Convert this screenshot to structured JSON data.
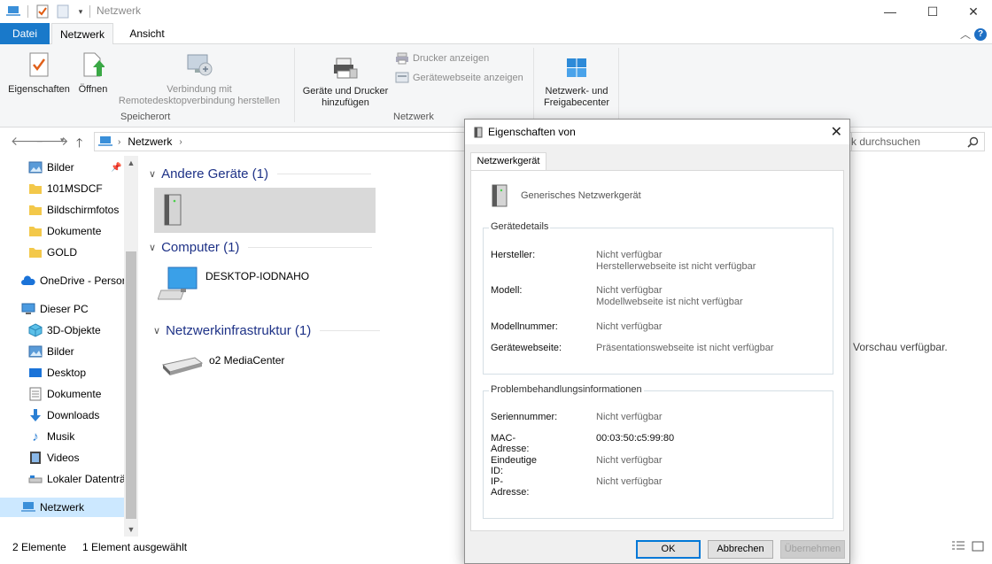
{
  "window": {
    "title": "Netzwerk",
    "minimize_glyph": "—",
    "maximize_glyph": "☐",
    "close_glyph": "✕"
  },
  "ribbon_tabs": {
    "file": "Datei",
    "network": "Netzwerk",
    "view": "Ansicht"
  },
  "ribbon": {
    "properties": "Eigenschaften",
    "open": "Öffnen",
    "remote_line1": "Verbindung mit",
    "remote_line2": "Remotedesktopverbindung herstellen",
    "group_location": "Speicherort",
    "add_devices_line1": "Geräte und Drucker",
    "add_devices_line2": "hinzufügen",
    "show_printers": "Drucker anzeigen",
    "show_device_webpage": "Gerätewebseite anzeigen",
    "group_network": "Netzwerk",
    "center_line1": "Netzwerk- und",
    "center_line2": "Freigabecenter"
  },
  "address": {
    "path": "Netzwerk",
    "search_placeholder": "k durchsuchen"
  },
  "nav": {
    "items": [
      {
        "label": "Bilder"
      },
      {
        "label": "101MSDCF"
      },
      {
        "label": "Bildschirmfotos"
      },
      {
        "label": "Dokumente"
      },
      {
        "label": "GOLD"
      },
      {
        "label": "OneDrive - Persor"
      },
      {
        "label": "Dieser PC"
      },
      {
        "label": "3D-Objekte"
      },
      {
        "label": "Bilder"
      },
      {
        "label": "Desktop"
      },
      {
        "label": "Dokumente"
      },
      {
        "label": "Downloads"
      },
      {
        "label": "Musik"
      },
      {
        "label": "Videos"
      },
      {
        "label": "Lokaler Datenträ"
      },
      {
        "label": "Netzwerk"
      }
    ]
  },
  "content": {
    "group_other": "Andere Geräte (1)",
    "group_computer": "Computer (1)",
    "computer_name": "DESKTOP-IODNAHO",
    "group_infra": "Netzwerkinfrastruktur (1)",
    "router_name": "o2 MediaCenter",
    "preview_text": "Vorschau verfügbar."
  },
  "status": {
    "count": "2 Elemente",
    "selected": "1 Element ausgewählt"
  },
  "dialog": {
    "title": "Eigenschaften von",
    "tab": "Netzwerkgerät",
    "device_name": "Generisches Netzwerkgerät",
    "details_legend": "Gerätedetails",
    "manufacturer_label": "Hersteller:",
    "manufacturer_value": "Nicht verfügbar",
    "manufacturer_web": "Herstellerwebseite ist nicht verfügbar",
    "model_label": "Modell:",
    "model_value": "Nicht verfügbar",
    "model_web": "Modellwebseite ist nicht verfügbar",
    "model_number_label": "Modellnummer:",
    "model_number_value": "Nicht verfügbar",
    "device_web_label": "Gerätewebseite:",
    "device_web_value": "Präsentationswebseite ist nicht verfügbar",
    "trouble_legend": "Problembehandlungsinformationen",
    "serial_label": "Seriennummer:",
    "serial_value": "Nicht verfügbar",
    "mac_label": "MAC-Adresse:",
    "mac_value": "00:03:50:c5:99:80",
    "uid_label": "Eindeutige ID:",
    "uid_value": "Nicht verfügbar",
    "ip_label": "IP-Adresse:",
    "ip_value": "Nicht verfügbar",
    "ok": "OK",
    "cancel": "Abbrechen",
    "apply": "Übernehmen"
  }
}
